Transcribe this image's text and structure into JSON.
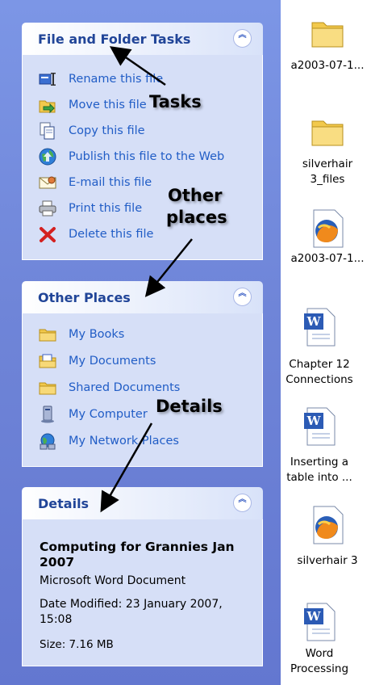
{
  "file_folder_tasks": {
    "title": "File and Folder Tasks",
    "items": [
      {
        "label": "Rename this file",
        "icon": "rename-icon"
      },
      {
        "label": "Move this file",
        "icon": "move-icon"
      },
      {
        "label": "Copy this file",
        "icon": "copy-icon"
      },
      {
        "label": "Publish this file to the Web",
        "icon": "publish-web-icon"
      },
      {
        "label": "E-mail this file",
        "icon": "email-icon"
      },
      {
        "label": "Print this file",
        "icon": "printer-icon"
      },
      {
        "label": "Delete this file",
        "icon": "delete-icon"
      }
    ]
  },
  "other_places": {
    "title": "Other Places",
    "items": [
      {
        "label": "My Books",
        "icon": "folder-icon"
      },
      {
        "label": "My Documents",
        "icon": "my-documents-icon"
      },
      {
        "label": "Shared Documents",
        "icon": "folder-icon"
      },
      {
        "label": "My Computer",
        "icon": "my-computer-icon"
      },
      {
        "label": "My Network Places",
        "icon": "network-places-icon"
      }
    ]
  },
  "details": {
    "title": "Details",
    "file_name": "Computing for Grannies Jan 2007",
    "file_type": "Microsoft Word Document",
    "date_modified": "Date Modified: 23 January 2007, 15:08",
    "size": "Size: 7.16 MB"
  },
  "annotations": {
    "tasks": "Tasks",
    "other_places_line1": "Other",
    "other_places_line2": "places",
    "details": "Details"
  },
  "files": [
    {
      "line1": "a2003-07-1...",
      "line2": "",
      "icon": "folder-icon"
    },
    {
      "line1": "silverhair",
      "line2": "3_files",
      "icon": "folder-icon"
    },
    {
      "line1": "a2003-07-1...",
      "line2": "",
      "icon": "firefox-html-icon"
    },
    {
      "line1": "Chapter 12",
      "line2": "Connections",
      "icon": "word-document-icon"
    },
    {
      "line1": "Inserting a",
      "line2": "table into ...",
      "icon": "word-document-icon"
    },
    {
      "line1": "silverhair 3",
      "line2": "",
      "icon": "firefox-html-icon"
    },
    {
      "line1": "Word",
      "line2": "Processing",
      "icon": "word-document-icon"
    }
  ]
}
